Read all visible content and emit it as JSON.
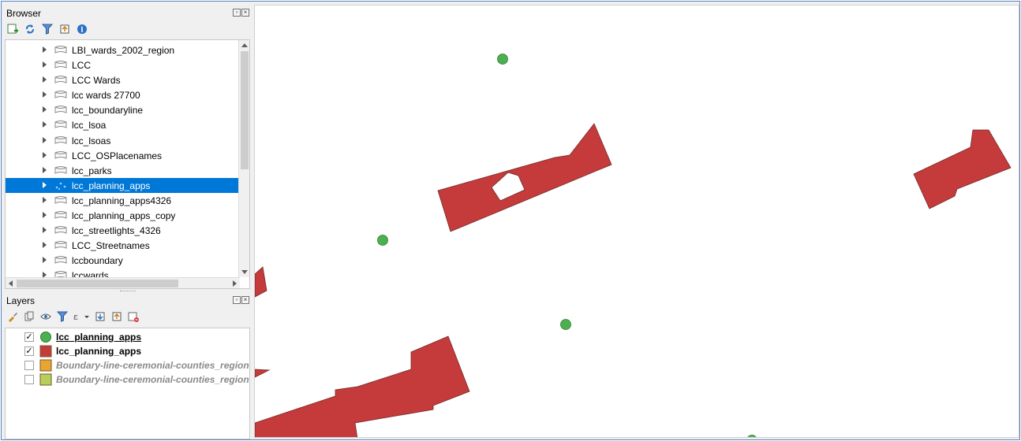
{
  "browser": {
    "title": "Browser",
    "toolbar": [
      "add-layer-icon",
      "refresh-icon",
      "filter-icon",
      "collapse-all-icon",
      "info-icon"
    ],
    "items": [
      {
        "label": "LBI_wards_2002_region"
      },
      {
        "label": "LCC"
      },
      {
        "label": "LCC Wards"
      },
      {
        "label": "lcc wards 27700"
      },
      {
        "label": "lcc_boundaryline"
      },
      {
        "label": "lcc_lsoa"
      },
      {
        "label": "lcc_lsoas"
      },
      {
        "label": "LCC_OSPlacenames"
      },
      {
        "label": "lcc_parks"
      },
      {
        "label": "lcc_planning_apps",
        "selected": true
      },
      {
        "label": "lcc_planning_apps4326"
      },
      {
        "label": "lcc_planning_apps_copy"
      },
      {
        "label": "lcc_streetlights_4326"
      },
      {
        "label": "LCC_Streetnames"
      },
      {
        "label": "lccboundary"
      },
      {
        "label": "lccwards"
      }
    ]
  },
  "layers": {
    "title": "Layers",
    "toolbar": [
      "style-brush-icon",
      "add-group-icon",
      "eye-icon",
      "filter-icon",
      "expression-filter-icon",
      "expand-all-icon",
      "collapse-all-icon",
      "remove-layer-icon"
    ],
    "items": [
      {
        "name": "lcc_planning_apps",
        "checked": "✓",
        "symbol": "green-circle",
        "color": "#4caf50",
        "style": "active"
      },
      {
        "name": "lcc_planning_apps",
        "checked": "✓",
        "symbol": "red-square",
        "color": "#c53a3a",
        "style": "on"
      },
      {
        "name": "Boundary-line-ceremonial-counties_region",
        "checked": "",
        "symbol": "orange-square",
        "color": "#e8a530",
        "style": "off"
      },
      {
        "name": "Boundary-line-ceremonial-counties_region",
        "checked": "",
        "symbol": "olive-square",
        "color": "#b6cf5a",
        "style": "off"
      }
    ]
  },
  "map": {
    "polygon_fill": "#c53a3a",
    "polygon_stroke": "#6e2a2a",
    "point_fill": "#4caf50",
    "point_stroke": "#2e7d32"
  }
}
